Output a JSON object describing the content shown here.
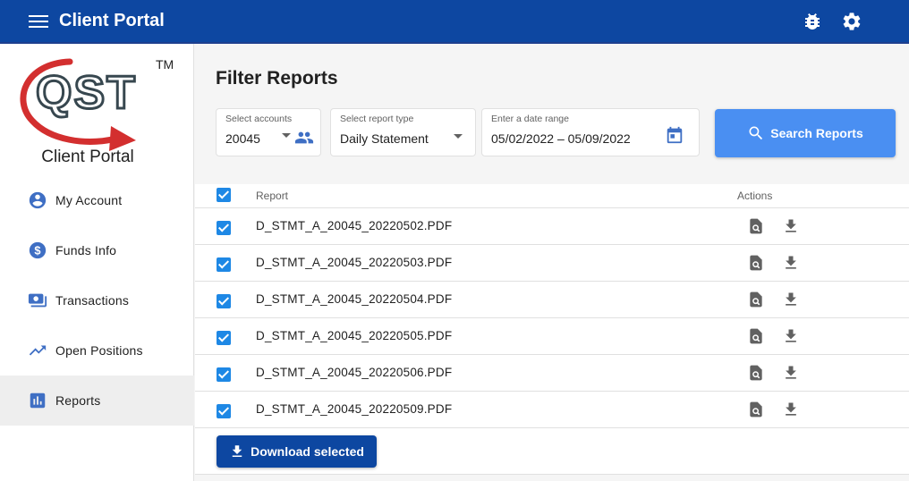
{
  "header": {
    "app_title": "Client Portal",
    "icons": [
      "menu-icon",
      "bug-icon",
      "gear-icon"
    ]
  },
  "sidebar": {
    "logo_text": "QST",
    "logo_tm": "TM",
    "logo_subtitle": "Client Portal",
    "items": [
      {
        "label": "My Account",
        "icon": "account-icon"
      },
      {
        "label": "Funds Info",
        "icon": "dollar-icon"
      },
      {
        "label": "Transactions",
        "icon": "transactions-icon"
      },
      {
        "label": "Open Positions",
        "icon": "trending-up-icon"
      },
      {
        "label": "Reports",
        "icon": "bar-chart-icon",
        "active": true
      }
    ]
  },
  "filter": {
    "title": "Filter Reports",
    "accounts": {
      "label": "Select accounts",
      "value": "20045"
    },
    "report_type": {
      "label": "Select report type",
      "value": "Daily Statement"
    },
    "date_range": {
      "label": "Enter a date range",
      "value": "05/02/2022 – 05/09/2022"
    },
    "search_label": "Search Reports"
  },
  "table": {
    "columns": [
      "Report",
      "Actions"
    ],
    "rows": [
      {
        "name": "D_STMT_A_20045_20220502.PDF",
        "checked": true
      },
      {
        "name": "D_STMT_A_20045_20220503.PDF",
        "checked": true
      },
      {
        "name": "D_STMT_A_20045_20220504.PDF",
        "checked": true
      },
      {
        "name": "D_STMT_A_20045_20220505.PDF",
        "checked": true
      },
      {
        "name": "D_STMT_A_20045_20220506.PDF",
        "checked": true
      },
      {
        "name": "D_STMT_A_20045_20220509.PDF",
        "checked": true
      }
    ]
  },
  "footer": {
    "download_label": "Download selected"
  },
  "colors": {
    "primary": "#0d47a1",
    "accent": "#4a8ff2",
    "checkbox": "#1e88e5",
    "logo_red": "#d32f2f",
    "logo_dark": "#37474f"
  }
}
